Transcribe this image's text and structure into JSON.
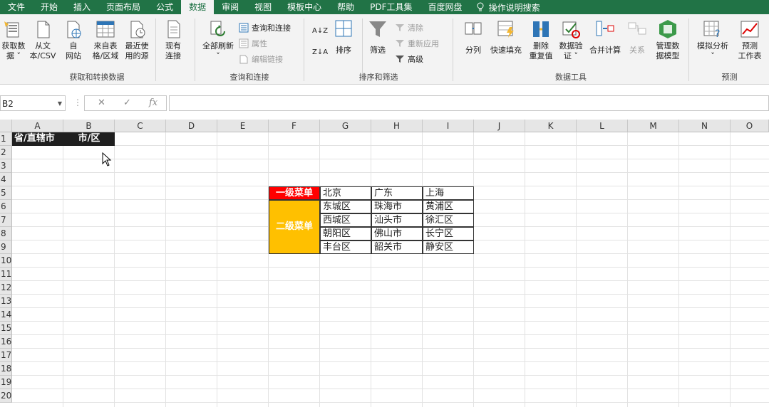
{
  "menu": {
    "tabs": [
      "文件",
      "开始",
      "插入",
      "页面布局",
      "公式",
      "数据",
      "审阅",
      "视图",
      "模板中心",
      "帮助",
      "PDF工具集",
      "百度网盘"
    ],
    "active_tab": "数据",
    "tell_me": "操作说明搜索"
  },
  "ribbon": {
    "get_transform": {
      "label": "获取和转换数据",
      "get_data": [
        "获取数",
        "据 ˅"
      ],
      "from_csv": [
        "从文",
        "本/CSV"
      ],
      "from_web": [
        "自",
        "网站"
      ],
      "from_table": [
        "来自表",
        "格/区域"
      ],
      "recent_sources": [
        "最近使",
        "用的源"
      ],
      "existing_connections": [
        "现有",
        "连接"
      ]
    },
    "queries": {
      "label": "查询和连接",
      "refresh_all": [
        "全部刷新",
        "˅"
      ],
      "queries_connections": "查询和连接",
      "properties": "属性",
      "edit_links": "编辑链接"
    },
    "sort_filter": {
      "label": "排序和筛选",
      "sort_az": "A↓Z",
      "sort_za": "Z↓A",
      "sort": "排序",
      "filter": "筛选",
      "clear": "清除",
      "reapply": "重新应用",
      "advanced": "高级"
    },
    "data_tools": {
      "label": "数据工具",
      "text_to_columns": "分列",
      "flash_fill": "快速填充",
      "remove_duplicates": [
        "删除",
        "重复值"
      ],
      "data_validation": [
        "数据验",
        "证 ˅"
      ],
      "consolidate": "合并计算",
      "relationships": "关系",
      "manage_model": [
        "管理数",
        "据模型"
      ]
    },
    "forecast": {
      "label": "预测",
      "what_if": [
        "模拟分析",
        "˅"
      ],
      "forecast_sheet": [
        "预测",
        "工作表"
      ]
    }
  },
  "formula_bar": {
    "name_box": "B2",
    "cancel": "✕",
    "enter": "✓",
    "fx": "fx",
    "content": ""
  },
  "sheet": {
    "columns": [
      "A",
      "B",
      "C",
      "D",
      "E",
      "F",
      "G",
      "H",
      "I",
      "J",
      "K",
      "L",
      "M",
      "N",
      "O"
    ],
    "rows": [
      "1",
      "2",
      "3",
      "4",
      "5",
      "6",
      "7",
      "8",
      "9",
      "10",
      "11",
      "12",
      "13",
      "14",
      "15",
      "16",
      "17",
      "18",
      "19",
      "20"
    ],
    "a1": "省/直辖市",
    "b1": "市/区",
    "level1_label": "一级菜单",
    "level2_label": "二级菜单",
    "provinces": [
      "北京",
      "广东",
      "上海"
    ],
    "districts": [
      [
        "东城区",
        "珠海市",
        "黄浦区"
      ],
      [
        "西城区",
        "汕头市",
        "徐汇区"
      ],
      [
        "朝阳区",
        "佛山市",
        "长宁区"
      ],
      [
        "丰台区",
        "韶关市",
        "静安区"
      ]
    ]
  },
  "colors": {
    "ribbon_green": "#217346",
    "level1_bg": "#ff0000",
    "level2_bg": "#ffc000",
    "header_bg": "#1f1f1f"
  }
}
